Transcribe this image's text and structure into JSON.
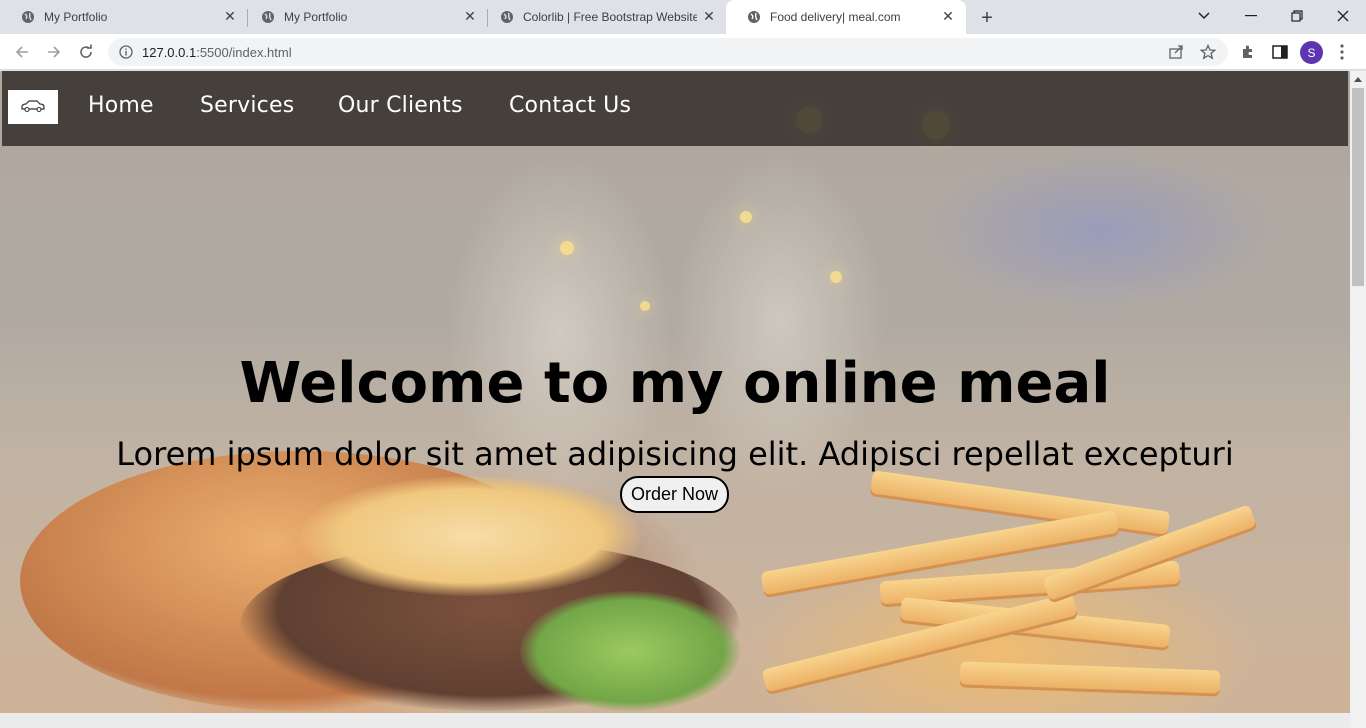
{
  "browser": {
    "tabs": [
      {
        "title": "My Portfolio",
        "active": false
      },
      {
        "title": "My Portfolio",
        "active": false
      },
      {
        "title": "Colorlib | Free Bootstrap Website Templates",
        "active": false
      },
      {
        "title": "Food delivery| meal.com",
        "active": true
      }
    ],
    "address": {
      "host": "127.0.0.1",
      "rest": ":5500/index.html"
    },
    "profile_initial": "S"
  },
  "site": {
    "nav": [
      "Home",
      "Services",
      "Our Clients",
      "Contact Us"
    ],
    "hero": {
      "title": "Welcome to my online meal",
      "subtitle": "Lorem ipsum dolor sit amet adipisicing elit. Adipisci repellat excepturi",
      "cta": "Order Now"
    }
  }
}
